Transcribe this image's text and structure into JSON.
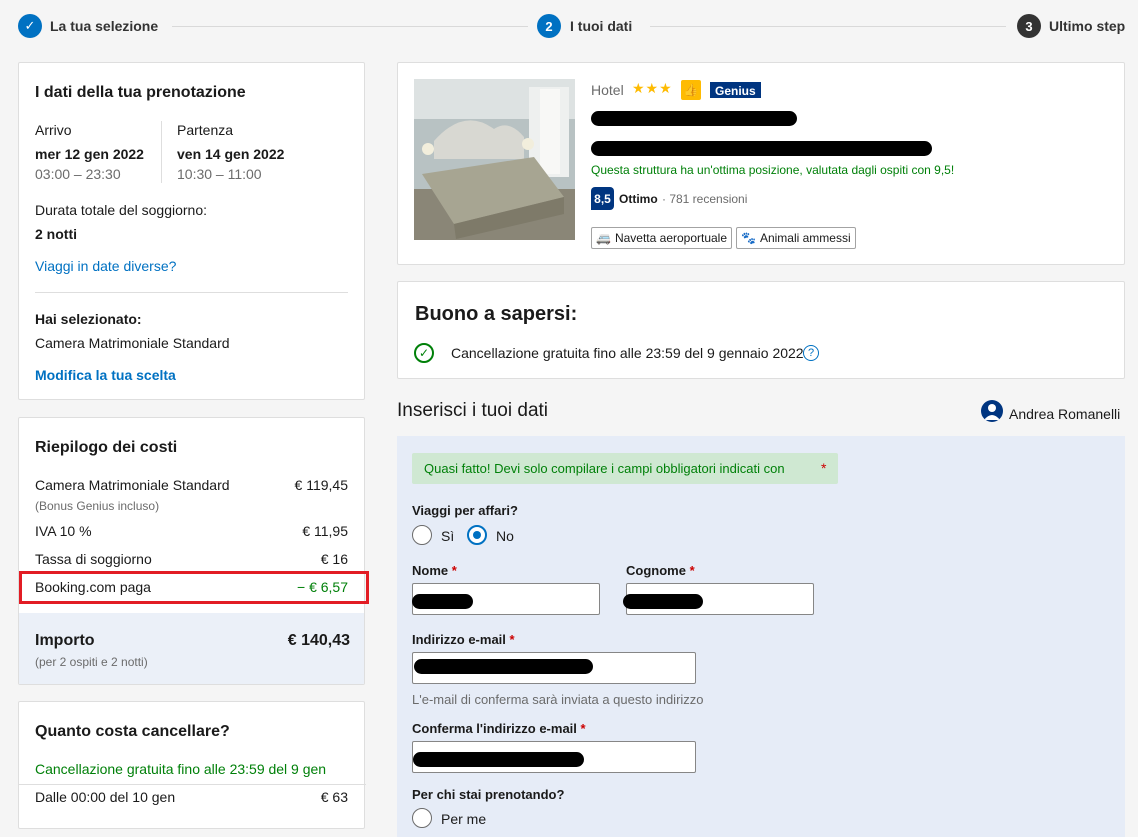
{
  "steps": [
    {
      "num": "✓",
      "label": "La tua selezione"
    },
    {
      "num": "2",
      "label": "I tuoi dati"
    },
    {
      "num": "3",
      "label": "Ultimo step"
    }
  ],
  "booking": {
    "title": "I dati della tua prenotazione",
    "checkin_label": "Arrivo",
    "checkin_date": "mer 12 gen 2022",
    "checkin_time": "03:00 – 23:30",
    "checkout_label": "Partenza",
    "checkout_date": "ven 14 gen 2022",
    "checkout_time": "10:30 – 11:00",
    "duration_label": "Durata totale del soggiorno:",
    "duration_value": "2 notti",
    "change_dates": "Viaggi in date diverse?",
    "selected_label": "Hai selezionato:",
    "selected_room": "Camera Matrimoniale Standard",
    "modify": "Modifica la tua scelta"
  },
  "costs": {
    "title": "Riepilogo dei costi",
    "rows": [
      {
        "label": "Camera Matrimoniale Standard",
        "note": "(Bonus Genius incluso)",
        "value": "€ 119,45"
      },
      {
        "label": "IVA 10 %",
        "value": "€ 11,95"
      },
      {
        "label": "Tassa di soggiorno",
        "value": "€ 16"
      },
      {
        "label": "Booking.com paga",
        "value": "− € 6,57"
      }
    ],
    "total_label": "Importo",
    "total_note": "(per 2 ospiti e 2 notti)",
    "total_value": "€ 140,43"
  },
  "cancel": {
    "title": "Quanto costa cancellare?",
    "free": "Cancellazione gratuita fino alle 23:59 del 9 gen",
    "from_label": "Dalle 00:00 del 10 gen",
    "from_value": "€ 63"
  },
  "hotel": {
    "type": "Hotel",
    "stars": "★★★",
    "genius": "Genius",
    "location_note": "Questa struttura ha un'ottima posizione, valutata dagli ospiti con 9,5!",
    "score": "8,5",
    "score_label": "Ottimo",
    "reviews": "· 781 recensioni",
    "amenities": [
      "Navetta aeroportuale",
      "Animali ammessi"
    ]
  },
  "good_to_know": {
    "title": "Buono a sapersi:",
    "text": "Cancellazione gratuita fino alle 23:59 del 9 gennaio 2022"
  },
  "form": {
    "title": "Inserisci i tuoi dati",
    "user_name": "Andrea Romanelli",
    "notice": "Quasi fatto! Devi solo compilare i campi obbligatori indicati con",
    "business_label": "Viaggi per affari?",
    "opt_yes": "Sì",
    "opt_no": "No",
    "first_name_label": "Nome",
    "last_name_label": "Cognome",
    "email_label": "Indirizzo e-mail",
    "email_hint": "L'e-mail di conferma sarà inviata a questo indirizzo",
    "email_confirm_label": "Conferma l'indirizzo e-mail",
    "for_whom_label": "Per chi stai prenotando?",
    "for_me": "Per me",
    "required_mark": "*"
  },
  "colors": {
    "brand": "#003580",
    "accent": "#0071c2",
    "green": "#008009",
    "highlight": "#e21c24"
  }
}
